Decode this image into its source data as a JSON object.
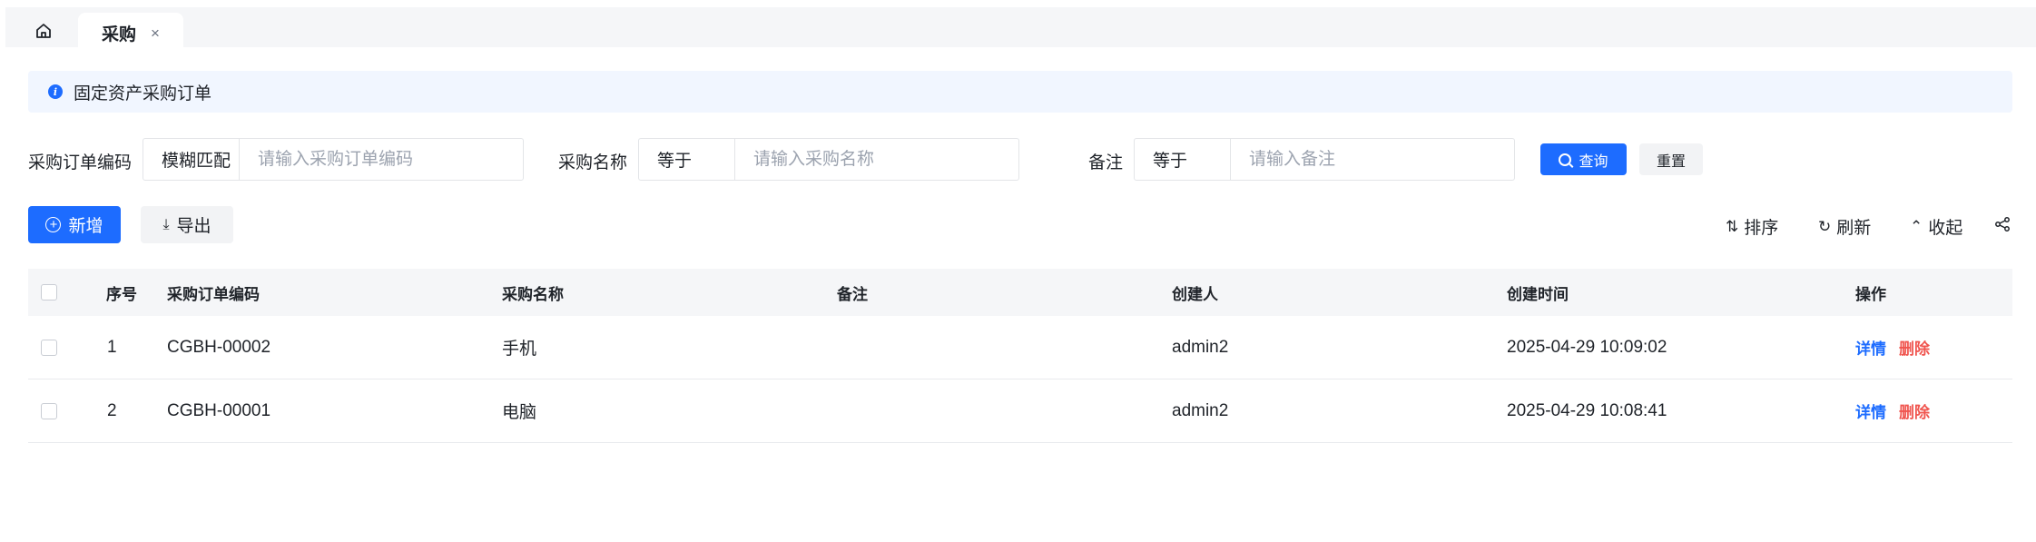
{
  "tabs": {
    "home_icon": "home-icon",
    "active": {
      "label": "采购",
      "close": "×"
    }
  },
  "banner": {
    "icon": "info-icon",
    "text": "固定资产采购订单"
  },
  "search": {
    "fields": [
      {
        "label": "采购订单编码",
        "operator": "模糊匹配",
        "placeholder": "请输入采购订单编码",
        "value": ""
      },
      {
        "label": "采购名称",
        "operator": "等于",
        "placeholder": "请输入采购名称",
        "value": ""
      },
      {
        "label": "备注",
        "operator": "等于",
        "placeholder": "请输入备注",
        "value": ""
      }
    ],
    "query_label": "查询",
    "reset_label": "重置"
  },
  "toolbar": {
    "add_label": "新增",
    "export_label": "导出",
    "sort_label": "排序",
    "refresh_label": "刷新",
    "collapse_label": "收起"
  },
  "table": {
    "columns": [
      "序号",
      "采购订单编码",
      "采购名称",
      "备注",
      "创建人",
      "创建时间",
      "操作"
    ],
    "rows": [
      {
        "index": "1",
        "code": "CGBH-00002",
        "name": "手机",
        "remark": "",
        "creator": "admin2",
        "created_at": "2025-04-29 10:09:02",
        "detail": "详情",
        "delete": "删除"
      },
      {
        "index": "2",
        "code": "CGBH-00001",
        "name": "电脑",
        "remark": "",
        "creator": "admin2",
        "created_at": "2025-04-29 10:08:41",
        "detail": "详情",
        "delete": "删除"
      }
    ]
  },
  "colors": {
    "primary": "#1d6cff",
    "danger": "#f0554f",
    "banner_bg": "#f1f6ff",
    "header_bg": "#f5f6f8"
  }
}
